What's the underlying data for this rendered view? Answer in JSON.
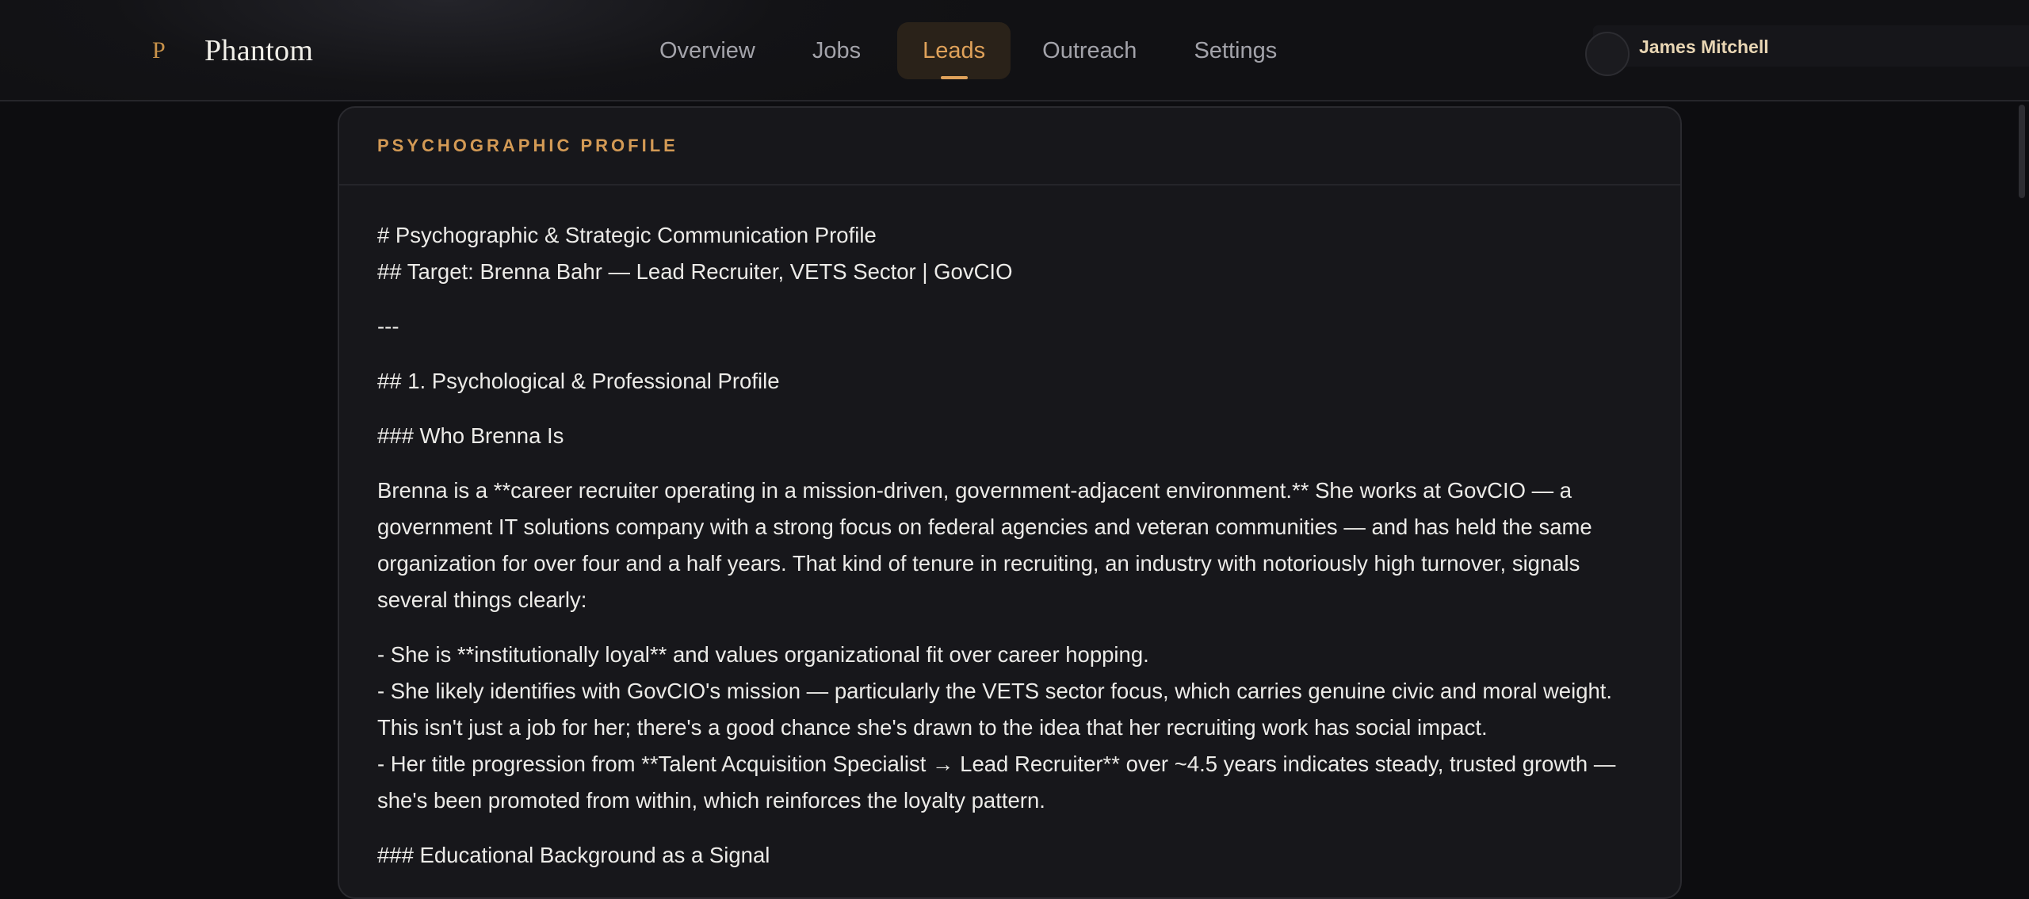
{
  "app": {
    "logo_mark": "P",
    "name": "Phantom"
  },
  "nav": {
    "items": [
      {
        "label": "Overview"
      },
      {
        "label": "Jobs"
      },
      {
        "label": "Leads"
      },
      {
        "label": "Outreach"
      },
      {
        "label": "Settings"
      }
    ],
    "active": "Leads"
  },
  "user": {
    "name": "James Mitchell"
  },
  "card": {
    "title": "PSYCHOGRAPHIC PROFILE",
    "content": {
      "h1": "# Psychographic & Strategic Communication Profile",
      "h2_target": "## Target: Brenna Bahr — Lead Recruiter, VETS Sector | GovCIO",
      "hr": "---",
      "h2_section1": "## 1. Psychological & Professional Profile",
      "h3_who": "### Who Brenna Is",
      "para_intro": "Brenna is a **career recruiter operating in a mission-driven, government-adjacent environment.** She works at GovCIO — a government IT solutions company with a strong focus on federal agencies and veteran communities — and has held the same organization for over four and a half years. That kind of tenure in recruiting, an industry with notoriously high turnover, signals several things clearly:",
      "bullet_1": "- She is **institutionally loyal** and values organizational fit over career hopping.",
      "bullet_2": "- She likely identifies with GovCIO's mission — particularly the VETS sector focus, which carries genuine civic and moral weight. This isn't just a job for her; there's a good chance she's drawn to the idea that her recruiting work has social impact.",
      "bullet_3": "- Her title progression from **Talent Acquisition Specialist → Lead Recruiter** over ~4.5 years indicates steady, trusted growth — she's been promoted from within, which reinforces the loyalty pattern.",
      "h3_edu": "### Educational Background as a Signal"
    }
  },
  "colors": {
    "accent": "#e0a25a",
    "background": "#0d0d10",
    "card": "#17171b"
  }
}
